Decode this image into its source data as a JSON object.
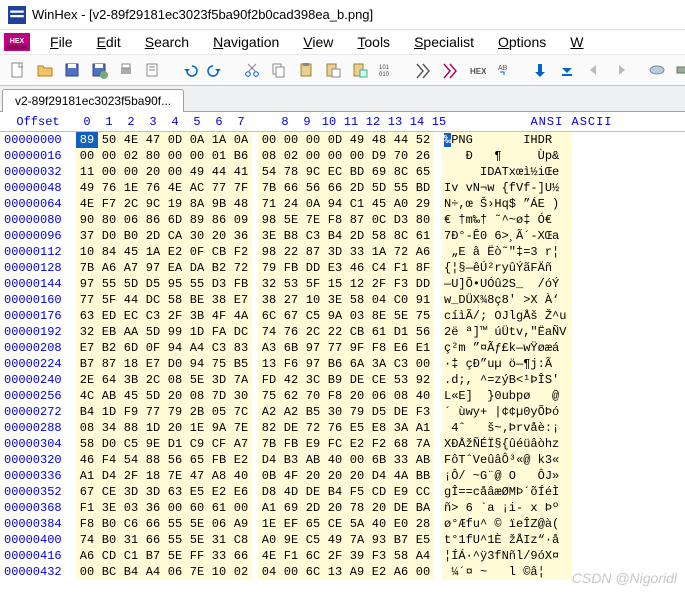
{
  "window": {
    "title": "WinHex - [v2-89f29181ec3023f5ba90f2b0cad398ea_b.png]"
  },
  "menu": [
    "File",
    "Edit",
    "Search",
    "Navigation",
    "View",
    "Tools",
    "Specialist",
    "Options",
    "W"
  ],
  "tab": {
    "label": "v2-89f29181ec3023f5ba90f..."
  },
  "headers": {
    "offset": "Offset",
    "cols": [
      "0",
      "1",
      "2",
      "3",
      "4",
      "5",
      "6",
      "7",
      "8",
      "9",
      "10",
      "11",
      "12",
      "13",
      "14",
      "15"
    ],
    "ascii": "ANSI ASCII"
  },
  "rows": [
    {
      "off": "00000000",
      "hex": [
        "89",
        "50",
        "4E",
        "47",
        "0D",
        "0A",
        "1A",
        "0A",
        "00",
        "00",
        "00",
        "0D",
        "49",
        "48",
        "44",
        "52"
      ],
      "asc": "‰PNG       IHDR"
    },
    {
      "off": "00000016",
      "hex": [
        "00",
        "00",
        "02",
        "80",
        "00",
        "00",
        "01",
        "B6",
        "08",
        "02",
        "00",
        "00",
        "00",
        "D9",
        "70",
        "26"
      ],
      "asc": "   Ð   ¶     Ùp&"
    },
    {
      "off": "00000032",
      "hex": [
        "11",
        "00",
        "00",
        "20",
        "00",
        "49",
        "44",
        "41",
        "54",
        "78",
        "9C",
        "EC",
        "BD",
        "69",
        "8C",
        "65"
      ],
      "asc": "     IDATxœì½iŒe"
    },
    {
      "off": "00000048",
      "hex": [
        "49",
        "76",
        "1E",
        "76",
        "4E",
        "AC",
        "77",
        "7F",
        "7B",
        "66",
        "56",
        "66",
        "2D",
        "5D",
        "55",
        "BD"
      ],
      "asc": "Iv vN¬w {fVf-]U½"
    },
    {
      "off": "00000064",
      "hex": [
        "4E",
        "F7",
        "2C",
        "9C",
        "19",
        "8A",
        "9B",
        "48",
        "71",
        "24",
        "0A",
        "94",
        "C1",
        "45",
        "A0",
        "29"
      ],
      "asc": "N÷,œ Š›Hq$ ”ÁE )"
    },
    {
      "off": "00000080",
      "hex": [
        "90",
        "80",
        "06",
        "86",
        "6D",
        "89",
        "86",
        "09",
        "98",
        "5E",
        "7E",
        "F8",
        "87",
        "0C",
        "D3",
        "80"
      ],
      "asc": "€ †m‰† ˜^~ø‡ Ó€"
    },
    {
      "off": "00000096",
      "hex": [
        "37",
        "D0",
        "B0",
        "2D",
        "CA",
        "30",
        "20",
        "36",
        "3E",
        "B8",
        "C3",
        "B4",
        "2D",
        "58",
        "8C",
        "61"
      ],
      "asc": "7Ð°-Ê0 6>¸Ã´-XŒa"
    },
    {
      "off": "00000112",
      "hex": [
        "10",
        "84",
        "45",
        "1A",
        "E2",
        "0F",
        "CB",
        "F2",
        "98",
        "22",
        "87",
        "3D",
        "33",
        "1A",
        "72",
        "A6"
      ],
      "asc": " „E â Ëò˜\"‡=3 r¦"
    },
    {
      "off": "00000128",
      "hex": [
        "7B",
        "A6",
        "A7",
        "97",
        "EA",
        "DA",
        "B2",
        "72",
        "79",
        "FB",
        "DD",
        "E3",
        "46",
        "C4",
        "F1",
        "8F"
      ],
      "asc": "{¦§—êÚ²ryûÝãFÄñ"
    },
    {
      "off": "00000144",
      "hex": [
        "97",
        "55",
        "5D",
        "D5",
        "95",
        "55",
        "D3",
        "FB",
        "32",
        "53",
        "5F",
        "15",
        "12",
        "2F",
        "F3",
        "DD"
      ],
      "asc": "—U]Õ•UÓû2S_  /óÝ"
    },
    {
      "off": "00000160",
      "hex": [
        "77",
        "5F",
        "44",
        "DC",
        "58",
        "BE",
        "38",
        "E7",
        "38",
        "27",
        "10",
        "3E",
        "58",
        "04",
        "C0",
        "91"
      ],
      "asc": "w_DÜX¾8ç8' >X À‘"
    },
    {
      "off": "00000176",
      "hex": [
        "63",
        "ED",
        "EC",
        "C3",
        "2F",
        "3B",
        "4F",
        "4A",
        "6C",
        "67",
        "C5",
        "9A",
        "03",
        "8E",
        "5E",
        "75"
      ],
      "asc": "cíìÃ/; OJlgÅš Ž^u"
    },
    {
      "off": "00000192",
      "hex": [
        "32",
        "EB",
        "AA",
        "5D",
        "99",
        "1D",
        "FA",
        "DC",
        "74",
        "76",
        "2C",
        "22",
        "CB",
        "61",
        "D1",
        "56"
      ],
      "asc": "2ë ª]™ úÜtv,\"ËaÑV"
    },
    {
      "off": "00000208",
      "hex": [
        "E7",
        "B2",
        "6D",
        "0F",
        "94",
        "A4",
        "C3",
        "83",
        "A3",
        "6B",
        "97",
        "77",
        "9F",
        "F8",
        "E6",
        "E1"
      ],
      "asc": "ç²m ”¤Ãƒ£k—wŸøæá"
    },
    {
      "off": "00000224",
      "hex": [
        "B7",
        "87",
        "18",
        "E7",
        "D0",
        "94",
        "75",
        "B5",
        "13",
        "F6",
        "97",
        "B6",
        "6A",
        "3A",
        "C3",
        "00"
      ],
      "asc": "·‡ çÐ”uµ ö—¶j:Ã "
    },
    {
      "off": "00000240",
      "hex": [
        "2E",
        "64",
        "3B",
        "2C",
        "08",
        "5E",
        "3D",
        "7A",
        "FD",
        "42",
        "3C",
        "B9",
        "DE",
        "CE",
        "53",
        "92"
      ],
      "asc": ".d;, ^=zýB<¹ÞÎS'"
    },
    {
      "off": "00000256",
      "hex": [
        "4C",
        "AB",
        "45",
        "5D",
        "20",
        "08",
        "7D",
        "30",
        "75",
        "62",
        "70",
        "F8",
        "20",
        "06",
        "08",
        "40"
      ],
      "asc": "L«E]  }0ubpø   @"
    },
    {
      "off": "00000272",
      "hex": [
        "B4",
        "1D",
        "F9",
        "77",
        "79",
        "2B",
        "05",
        "7C",
        "A2",
        "A2",
        "B5",
        "30",
        "79",
        "D5",
        "DE",
        "F3"
      ],
      "asc": "´ ùwy+ |¢¢µ0yÕÞó"
    },
    {
      "off": "00000288",
      "hex": [
        "08",
        "34",
        "88",
        "1D",
        "20",
        "1E",
        "9A",
        "7E",
        "82",
        "DE",
        "72",
        "76",
        "E5",
        "E8",
        "3A",
        "A1"
      ],
      "asc": " 4ˆ   š~‚Þrvåè:¡"
    },
    {
      "off": "00000304",
      "hex": [
        "58",
        "D0",
        "C5",
        "9E",
        "D1",
        "C9",
        "CF",
        "A7",
        "7B",
        "FB",
        "E9",
        "FC",
        "E2",
        "F2",
        "68",
        "7A"
      ],
      "asc": "XÐÅžÑÉÏ§{ûéüâòhz"
    },
    {
      "off": "00000320",
      "hex": [
        "46",
        "F4",
        "54",
        "88",
        "56",
        "65",
        "FB",
        "E2",
        "D4",
        "B3",
        "AB",
        "40",
        "00",
        "6B",
        "33",
        "AB"
      ],
      "asc": "FôTˆVeûâÔ³«@ k3«"
    },
    {
      "off": "00000336",
      "hex": [
        "A1",
        "D4",
        "2F",
        "18",
        "7E",
        "47",
        "A8",
        "40",
        "0B",
        "4F",
        "20",
        "20",
        "20",
        "D4",
        "4A",
        "BB"
      ],
      "asc": "¡Ô/ ~G¨@ O   ÔJ»"
    },
    {
      "off": "00000352",
      "hex": [
        "67",
        "CE",
        "3D",
        "3D",
        "63",
        "E5",
        "E2",
        "E6",
        "D8",
        "4D",
        "DE",
        "B4",
        "F5",
        "CD",
        "E9",
        "CC"
      ],
      "asc": "gÎ==cåâæØMÞ´õÍéÌ"
    },
    {
      "off": "00000368",
      "hex": [
        "F1",
        "3E",
        "03",
        "36",
        "00",
        "60",
        "61",
        "00",
        "A1",
        "69",
        "2D",
        "20",
        "78",
        "20",
        "DE",
        "BA"
      ],
      "asc": "ñ> 6 `a ¡i- x Þº"
    },
    {
      "off": "00000384",
      "hex": [
        "F8",
        "B0",
        "C6",
        "66",
        "55",
        "5E",
        "06",
        "A9",
        "1E",
        "EF",
        "65",
        "CE",
        "5A",
        "40",
        "E0",
        "28"
      ],
      "asc": "ø°Æfu^ © ïeÎZ@à("
    },
    {
      "off": "00000400",
      "hex": [
        "74",
        "B0",
        "31",
        "66",
        "55",
        "5E",
        "31",
        "C8",
        "A0",
        "9E",
        "C5",
        "49",
        "7A",
        "93",
        "B7",
        "E5"
      ],
      "asc": "t°1fU^1È žÅIz“·å"
    },
    {
      "off": "00000416",
      "hex": [
        "A6",
        "CD",
        "C1",
        "B7",
        "5E",
        "FF",
        "33",
        "66",
        "4E",
        "F1",
        "6C",
        "2F",
        "39",
        "F3",
        "58",
        "A4"
      ],
      "asc": "¦ÍÁ·^ÿ3fNñl/9óX¤"
    },
    {
      "off": "00000432",
      "hex": [
        "00",
        "BC",
        "B4",
        "A4",
        "06",
        "7E",
        "10",
        "02",
        "04",
        "00",
        "6C",
        "13",
        "A9",
        "E2",
        "A6",
        "00"
      ],
      "asc": " ¼´¤ ~   l ©â¦ "
    }
  ],
  "watermark": "CSDN @Nigoridl"
}
